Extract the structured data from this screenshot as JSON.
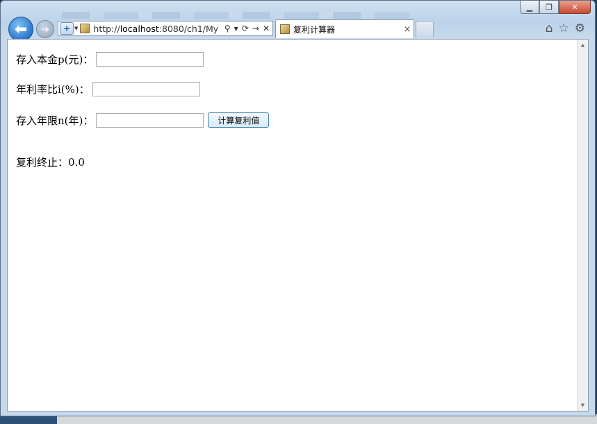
{
  "browser": {
    "url_prefix": "http://",
    "url_host": "localhost",
    "url_rest": ":8080/ch1/My",
    "tab_title": "复利计算器",
    "tab_close": "×",
    "new_tab": ""
  },
  "form": {
    "principal_label": "存入本金p(元)：",
    "principal_value": "",
    "rate_label": "年利率比i(%)：",
    "rate_value": "",
    "years_label": "存入年限n(年)：",
    "years_value": "",
    "calc_button": "计算复利值"
  },
  "result": {
    "label": "复利终止：",
    "value": "0.0"
  },
  "icons": {
    "back": "back-arrow-icon",
    "forward": "forward-arrow-icon",
    "search": "search-icon",
    "refresh": "refresh-icon",
    "stop": "close-icon",
    "home": "home-icon",
    "favorites": "star-icon",
    "tools": "gear-icon"
  },
  "colors": {
    "accent": "#2a76c9",
    "frame": "#bcd3ea",
    "button_border": "#3c7fb1"
  }
}
